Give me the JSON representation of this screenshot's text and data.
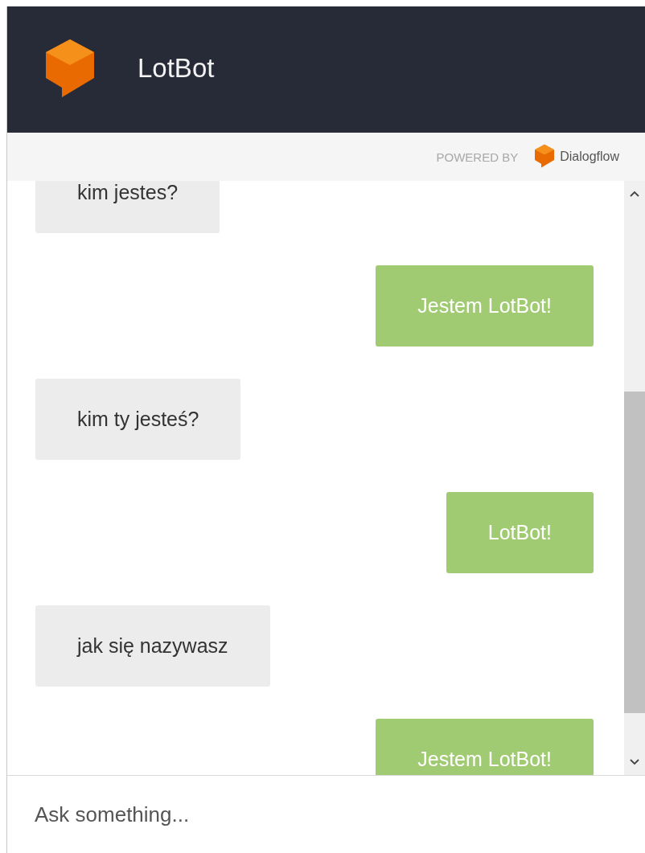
{
  "header": {
    "title": "LotBot"
  },
  "powered_by": {
    "label": "POWERED BY",
    "brand": "Dialogflow"
  },
  "messages": [
    {
      "kind": "user",
      "text": "kim jestes?"
    },
    {
      "kind": "bot",
      "text": "Jestem LotBot!"
    },
    {
      "kind": "user",
      "text": "kim ty jesteś?"
    },
    {
      "kind": "bot",
      "text": "LotBot!"
    },
    {
      "kind": "user",
      "text": "jak się nazywasz"
    },
    {
      "kind": "bot",
      "text": "Jestem LotBot!"
    }
  ],
  "input": {
    "placeholder": "Ask something..."
  }
}
